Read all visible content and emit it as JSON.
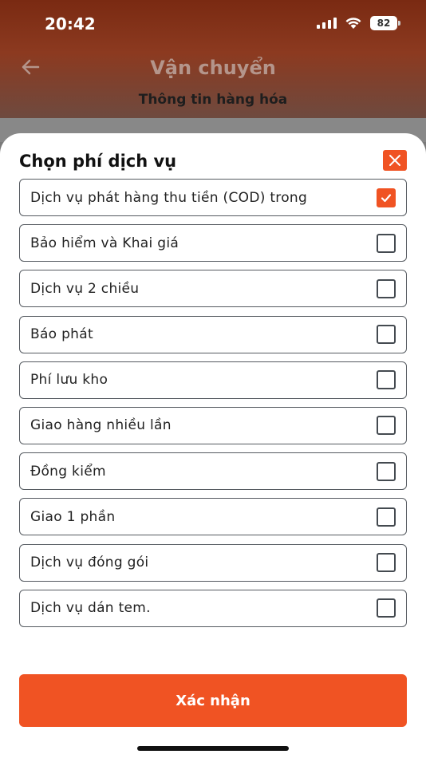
{
  "status_bar": {
    "time": "20:42",
    "battery": "82",
    "icons": [
      "signal-icon",
      "wifi-icon",
      "battery-icon"
    ]
  },
  "header": {
    "title": "Vận chuyển",
    "subtitle": "Thông tin hàng hóa",
    "back_icon": "arrow-left-icon"
  },
  "sheet": {
    "title": "Chọn phí dịch vụ",
    "close_icon": "close-icon",
    "options": [
      {
        "label": "Dịch vụ phát hàng thu tiền (COD) trong",
        "checked": true
      },
      {
        "label": "Bảo hiểm và Khai giá",
        "checked": false
      },
      {
        "label": "Dịch vụ 2 chiều",
        "checked": false
      },
      {
        "label": "Báo phát",
        "checked": false
      },
      {
        "label": "Phí lưu kho",
        "checked": false
      },
      {
        "label": "Giao hàng nhiều lần",
        "checked": false
      },
      {
        "label": "Đồng kiểm",
        "checked": false
      },
      {
        "label": "Giao 1 phần",
        "checked": false
      },
      {
        "label": "Dịch vụ đóng gói",
        "checked": false
      },
      {
        "label": "Dịch vụ dán tem.",
        "checked": false
      }
    ],
    "confirm_label": "Xác nhận"
  },
  "colors": {
    "accent": "#f05323",
    "header_bg": "#7a2a12"
  }
}
